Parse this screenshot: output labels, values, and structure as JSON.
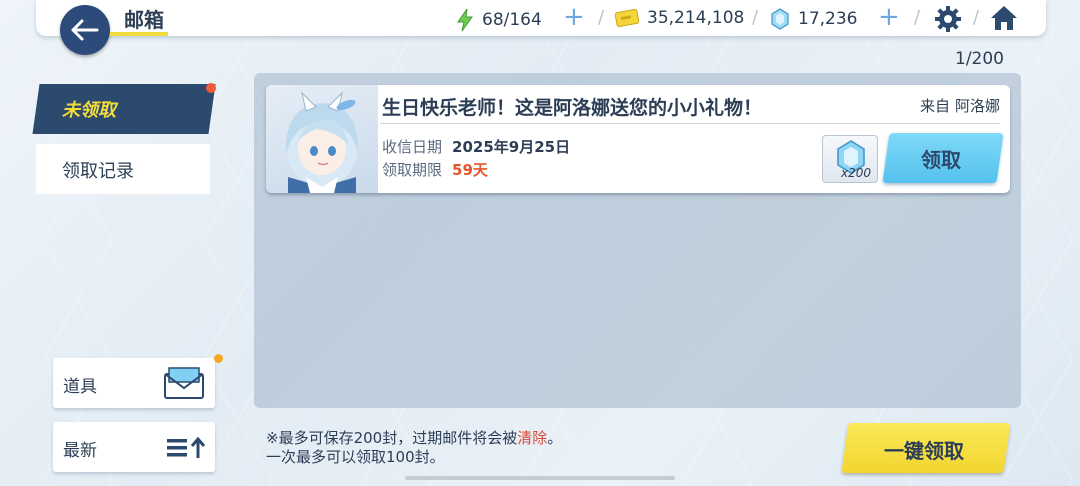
{
  "header": {
    "title": "邮箱",
    "ap": "68/164",
    "credits": "35,214,108",
    "pyroxene": "17,236"
  },
  "tabs": {
    "unclaimed": "未领取",
    "history": "领取记录"
  },
  "side": {
    "category_label": "道具",
    "sort_label": "最新"
  },
  "mail_count": "1/200",
  "mails": [
    {
      "subject": "生日快乐老师！这是阿洛娜送您的小小礼物！",
      "from_label": "来自",
      "from_name": "阿洛娜",
      "received_label": "收信日期",
      "received_date": "2025年9月25日",
      "deadline_label": "领取期限",
      "deadline_value": "59天",
      "reward_qty": "x200",
      "claim_label": "领取"
    }
  ],
  "footer": {
    "note_line1_prefix": "※最多可保存200封，过期邮件将会被",
    "note_line1_highlight": "清除",
    "note_line1_suffix": "。",
    "note_line2": "一次最多可以领取100封。",
    "claim_all_label": "一键领取"
  },
  "colors": {
    "accent_yellow": "#f2dc3c",
    "navy": "#2c4a6e",
    "claim_blue": "#54c2ef",
    "warn_orange": "#e8542a"
  }
}
